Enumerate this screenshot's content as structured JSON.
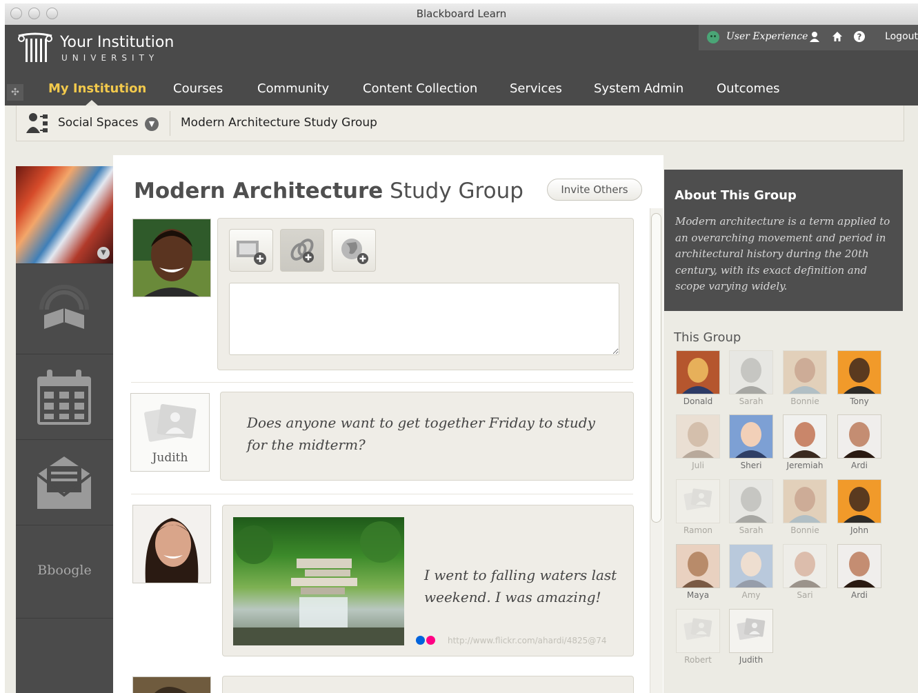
{
  "window": {
    "title": "Blackboard Learn"
  },
  "header": {
    "institution_name": "Your Institution",
    "institution_sub": "UNIVERSITY",
    "user_name": "User Experience",
    "logout_label": "Logout"
  },
  "nav": {
    "items": [
      {
        "label": "My Institution",
        "active": true
      },
      {
        "label": "Courses"
      },
      {
        "label": "Community"
      },
      {
        "label": "Content Collection"
      },
      {
        "label": "Services"
      },
      {
        "label": "System Admin"
      },
      {
        "label": "Outcomes"
      }
    ]
  },
  "breadcrumb": {
    "section": "Social Spaces",
    "current": "Modern Architecture Study Group"
  },
  "rail": {
    "bboogle_label": "Bboogle"
  },
  "main": {
    "title_bold": "Modern Architecture",
    "title_rest": "Study Group",
    "invite_label": "Invite Others",
    "composer": {
      "value": ""
    },
    "posts": [
      {
        "author": "Judith",
        "text": "Does anyone want to get together Friday to study for the midterm?"
      },
      {
        "text": "I went to falling waters last weekend. I was amazing!",
        "link": "http://www.flickr.com/ahardi/4825@74"
      }
    ]
  },
  "about": {
    "title": "About This Group",
    "text": "Modern architecture is a term applied to an overarching movement and period in architectural history during the 20th century, with its exact definition and scope varying widely."
  },
  "group": {
    "title": "This Group",
    "members": [
      {
        "name": "Donald",
        "active": true
      },
      {
        "name": "Sarah",
        "active": false
      },
      {
        "name": "Bonnie",
        "active": false
      },
      {
        "name": "Tony",
        "active": true
      },
      {
        "name": "Juli",
        "active": false
      },
      {
        "name": "Sheri",
        "active": true
      },
      {
        "name": "Jeremiah",
        "active": true
      },
      {
        "name": "Ardi",
        "active": true
      },
      {
        "name": "Ramon",
        "active": false
      },
      {
        "name": "Sarah",
        "active": false
      },
      {
        "name": "Bonnie",
        "active": false
      },
      {
        "name": "John",
        "active": true
      },
      {
        "name": "Maya",
        "active": true
      },
      {
        "name": "Amy",
        "active": false
      },
      {
        "name": "Sari",
        "active": false
      },
      {
        "name": "Ardi",
        "active": true
      },
      {
        "name": "Robert",
        "active": false
      },
      {
        "name": "Judith",
        "active": true
      }
    ]
  },
  "colors": {
    "active_nav": "#f2c94c",
    "header_bg": "#4a4a4a",
    "flickr_blue": "#0063dc",
    "flickr_pink": "#ff0084"
  }
}
